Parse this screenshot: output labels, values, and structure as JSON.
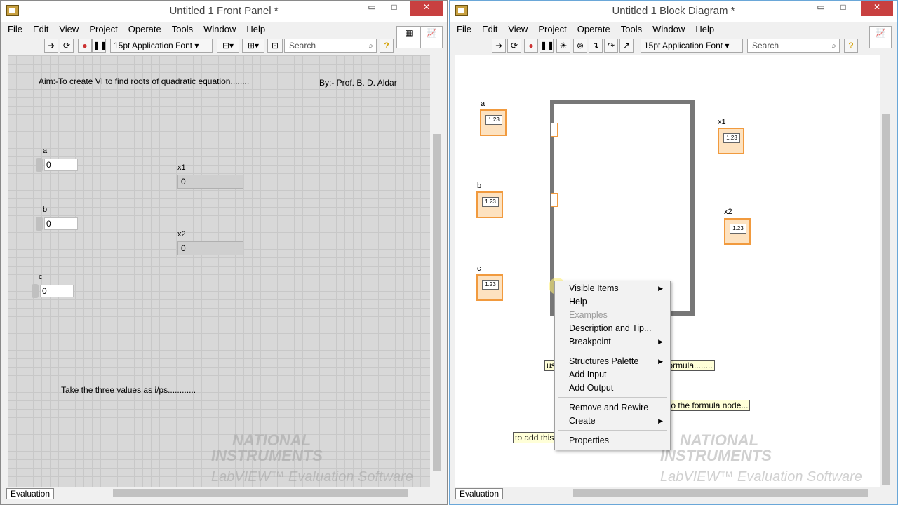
{
  "front_panel": {
    "title": "Untitled 1 Front Panel *",
    "menu": [
      "File",
      "Edit",
      "View",
      "Project",
      "Operate",
      "Tools",
      "Window",
      "Help"
    ],
    "font": "15pt Application Font",
    "search_placeholder": "Search",
    "aim_text": "Aim:-To create VI to find roots of quadratic equation........",
    "by_text": "By:- Prof. B. D. Aldar",
    "controls": [
      {
        "label": "a",
        "value": "0"
      },
      {
        "label": "b",
        "value": "0"
      },
      {
        "label": "c",
        "value": "0"
      }
    ],
    "indicators": [
      {
        "label": "x1",
        "value": "0"
      },
      {
        "label": "x2",
        "value": "0"
      }
    ],
    "note": "Take the three values as i/ps............",
    "status": "Evaluation"
  },
  "block_diagram": {
    "title": "Untitled 1 Block Diagram *",
    "menu": [
      "File",
      "Edit",
      "View",
      "Project",
      "Operate",
      "Tools",
      "Window",
      "Help"
    ],
    "font": "15pt Application Font",
    "search_placeholder": "Search",
    "terminals": [
      {
        "label": "a",
        "text": "1.23"
      },
      {
        "label": "b",
        "text": "1.23"
      },
      {
        "label": "c",
        "text": "1.23"
      },
      {
        "label": "x1",
        "text": "1.23"
      },
      {
        "label": "x2",
        "text": "1.23"
      }
    ],
    "tips": [
      "us",
      "formula........",
      "to the formula node...",
      "to add this"
    ],
    "context_menu": [
      {
        "label": "Visible Items",
        "submenu": true,
        "disabled": false
      },
      {
        "label": "Help",
        "submenu": false,
        "disabled": false
      },
      {
        "label": "Examples",
        "submenu": false,
        "disabled": true
      },
      {
        "label": "Description and Tip...",
        "submenu": false,
        "disabled": false
      },
      {
        "label": "Breakpoint",
        "submenu": true,
        "disabled": false
      },
      {
        "label": "Structures Palette",
        "submenu": true,
        "disabled": false
      },
      {
        "label": "Add Input",
        "submenu": false,
        "disabled": false
      },
      {
        "label": "Add Output",
        "submenu": false,
        "disabled": false
      },
      {
        "label": "Remove and Rewire",
        "submenu": false,
        "disabled": false
      },
      {
        "label": "Create",
        "submenu": true,
        "disabled": false
      },
      {
        "label": "Properties",
        "submenu": false,
        "disabled": false
      }
    ],
    "status": "Evaluation"
  },
  "watermark": {
    "line1": "NATIONAL",
    "line2": "INSTRUMENTS",
    "line3": "LabVIEW™ Evaluation Software"
  },
  "window_controls": {
    "min": "▭",
    "max": "□",
    "close": "✕"
  }
}
